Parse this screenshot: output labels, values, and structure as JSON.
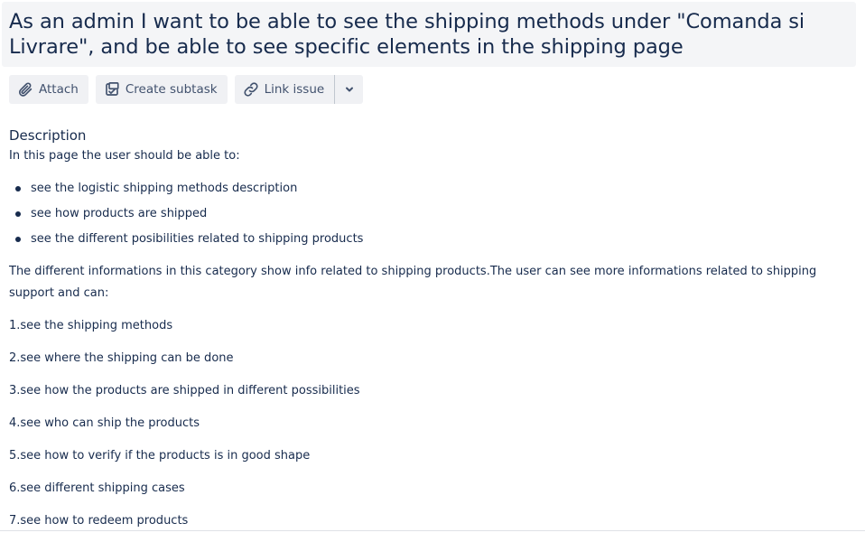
{
  "issue": {
    "title": "As an admin I want to be able to see the shipping methods under \"Comanda si Livrare\", and be able to see specific elements in the shipping page"
  },
  "toolbar": {
    "attach_label": "Attach",
    "attach_icon": "paperclip-icon",
    "create_subtask_label": "Create subtask",
    "create_subtask_icon": "subtask-icon",
    "link_issue_label": "Link issue",
    "link_issue_icon": "link-icon",
    "more_icon": "chevron-down-icon"
  },
  "description": {
    "heading": "Description",
    "intro": "In this page the user should be able to:",
    "bullets": [
      "see the logistic shipping methods description",
      "see how products are shipped",
      "see the different posibilities related to shipping products"
    ],
    "paragraph": "The different informations in this category show info related to shipping products.The user can see more informations related to shipping support and can:",
    "numbered": [
      "1.see the shipping methods",
      "2.see where the shipping can be done",
      "3.see how the products are shipped in different possibilities",
      "4.see who can ship the products",
      "5.see how to verify if the products is in good shape",
      "6.see different shipping cases",
      "7.see how to redeem products"
    ]
  },
  "colors": {
    "title_background": "#f4f5f7",
    "button_background": "#f0f1f4",
    "text": "#172b4d",
    "button_text": "#42526e"
  }
}
